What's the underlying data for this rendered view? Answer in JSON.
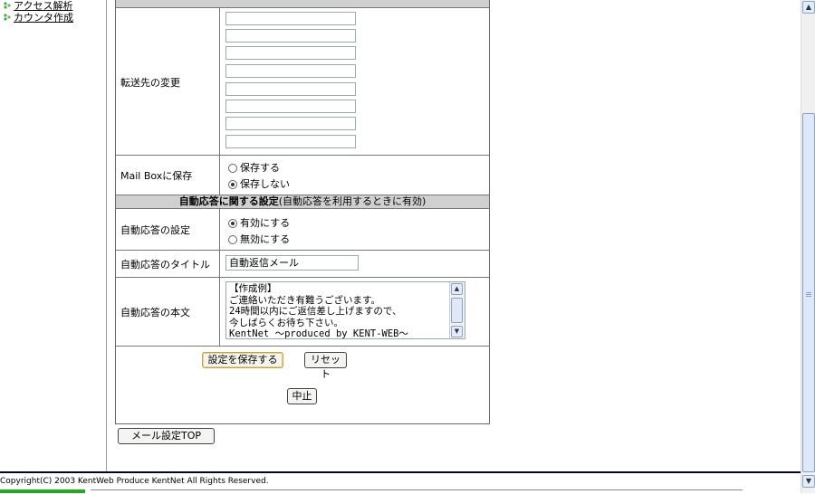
{
  "sidebar": {
    "links": [
      {
        "label": "アクセス解析"
      },
      {
        "label": "カウンタ作成"
      }
    ]
  },
  "settings": {
    "forward": {
      "label": "転送先の変更",
      "inputs": [
        "",
        "",
        "",
        "",
        "",
        "",
        "",
        ""
      ]
    },
    "mailbox": {
      "label": "Mail Boxに保存",
      "options": [
        "保存する",
        "保存しない"
      ],
      "selected": "保存しない"
    },
    "autoreply_header": {
      "title": "自動応答に関する設定",
      "note": "(自動応答を利用するときに有効)"
    },
    "autoreply": {
      "label": "自動応答の設定",
      "options": [
        "有効にする",
        "無効にする"
      ],
      "selected": "有効にする"
    },
    "reply_title": {
      "label": "自動応答のタイトル",
      "value": "自動返信メール"
    },
    "reply_body": {
      "label": "自動応答の本文",
      "value": "【作成例】\nご連絡いただき有難うございます。\n24時間以内にご返信差し上げますので、\n今しばらくお待ち下さい。\nKentNet 〜produced by KENT-WEB〜"
    }
  },
  "buttons": {
    "save": "設定を保存する",
    "reset": "リセット",
    "cancel": "中止",
    "top": "メール設定TOP"
  },
  "footer": {
    "copyright": "Copyright(C) 2003 KentWeb Produce KentNet All Rights Reserved."
  },
  "colors": {
    "header_bg": "#d0d0d0",
    "bottom_bar": "#000033",
    "scroll_accent": "#8aa0c8"
  }
}
